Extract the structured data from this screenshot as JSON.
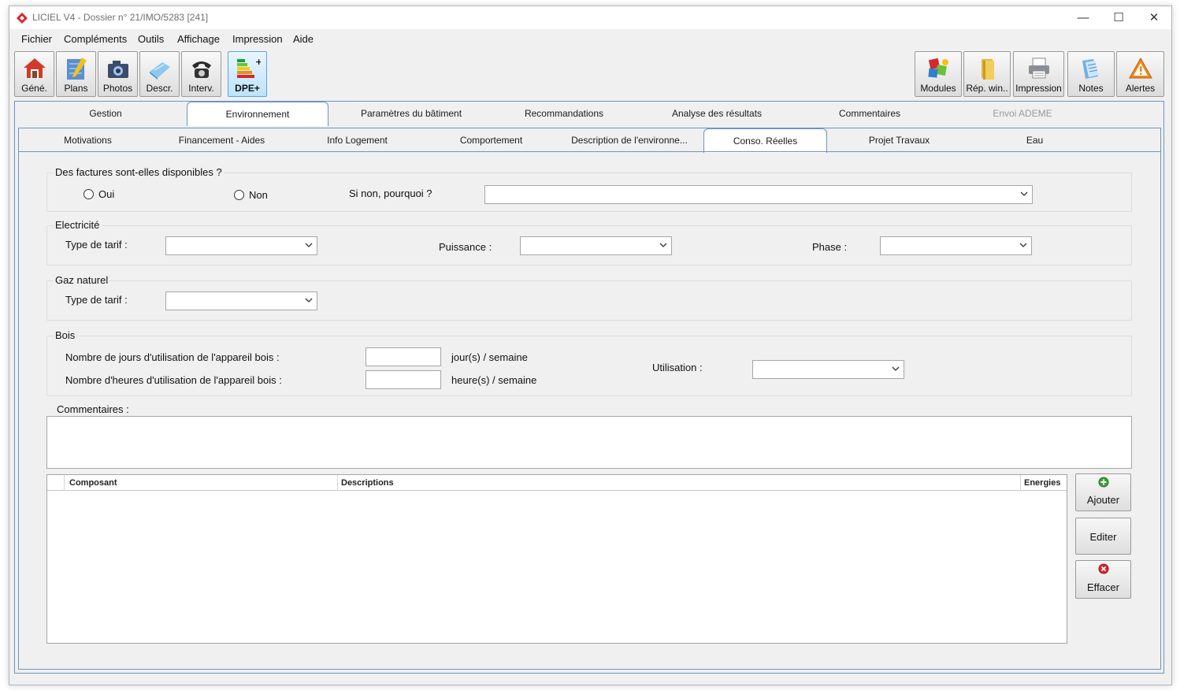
{
  "window": {
    "title": "LICIEL V4 - Dossier n° 21/IMO/5283 [241]",
    "minimize": "—",
    "maximize": "☐",
    "close": "✕"
  },
  "menu": {
    "items": [
      "Fichier",
      "Compléments",
      "Outils",
      "Affichage",
      "Impression",
      "Aide"
    ]
  },
  "toolbar_left": [
    {
      "label": "Géné.",
      "icon": "house-icon"
    },
    {
      "label": "Plans",
      "icon": "plans-icon"
    },
    {
      "label": "Photos",
      "icon": "camera-icon"
    },
    {
      "label": "Descr.",
      "icon": "description-icon"
    },
    {
      "label": "Interv.",
      "icon": "telephone-icon"
    },
    {
      "label": "DPE+",
      "icon": "dpe-energy-icon",
      "active": true
    }
  ],
  "toolbar_right": [
    {
      "label": "Modules",
      "icon": "modules-icon"
    },
    {
      "label": "Rép. win..",
      "icon": "folder-icon"
    },
    {
      "label": "Impression",
      "icon": "printer-icon"
    },
    {
      "label": "Notes",
      "icon": "notes-icon"
    },
    {
      "label": "Alertes",
      "icon": "warning-icon"
    }
  ],
  "main_tabs": [
    {
      "label": "Gestion"
    },
    {
      "label": "Environnement",
      "active": true
    },
    {
      "label": "Paramètres du bâtiment"
    },
    {
      "label": "Recommandations"
    },
    {
      "label": "Analyse des résultats"
    },
    {
      "label": "Commentaires"
    },
    {
      "label": "Envoi ADEME",
      "disabled": true
    }
  ],
  "sub_tabs": [
    {
      "label": "Motivations"
    },
    {
      "label": "Financement  - Aides"
    },
    {
      "label": "Info Logement"
    },
    {
      "label": "Comportement"
    },
    {
      "label": "Description de l'environne..."
    },
    {
      "label": "Conso. Réelles",
      "active": true
    },
    {
      "label": "Projet Travaux"
    },
    {
      "label": "Eau"
    }
  ],
  "factures": {
    "title": "Des factures sont-elles disponibles ?",
    "oui": "Oui",
    "non": "Non",
    "pourquoi_label": "Si non, pourquoi ?",
    "pourquoi_value": ""
  },
  "electricite": {
    "title": "Electricité",
    "tarif_label": "Type de tarif :",
    "tarif_value": "",
    "puissance_label": "Puissance :",
    "puissance_value": "",
    "phase_label": "Phase :",
    "phase_value": ""
  },
  "gaz": {
    "title": "Gaz naturel",
    "tarif_label": "Type de tarif :",
    "tarif_value": ""
  },
  "bois": {
    "title": "Bois",
    "jours_label": "Nombre de jours d'utilisation de l'appareil bois :",
    "jours_value": "",
    "jours_unit": "jour(s) / semaine",
    "heures_label": "Nombre d'heures d'utilisation de l'appareil bois :",
    "heures_value": "",
    "heures_unit": "heure(s) / semaine",
    "utilisation_label": "Utilisation :",
    "utilisation_value": ""
  },
  "commentaires": {
    "label": "Commentaires :",
    "value": ""
  },
  "grid": {
    "columns": [
      "",
      "Composant",
      "Descriptions",
      "Energies"
    ],
    "rows": []
  },
  "side_buttons": {
    "ajouter": "Ajouter",
    "editer": "Editer",
    "effacer": "Effacer"
  },
  "colors": {
    "accent_border": "#6f94c1",
    "active_toolbar": "#bde3fb",
    "add_green": "#3aa13a",
    "delete_red": "#d9262b",
    "alert_orange": "#f08a1c"
  }
}
